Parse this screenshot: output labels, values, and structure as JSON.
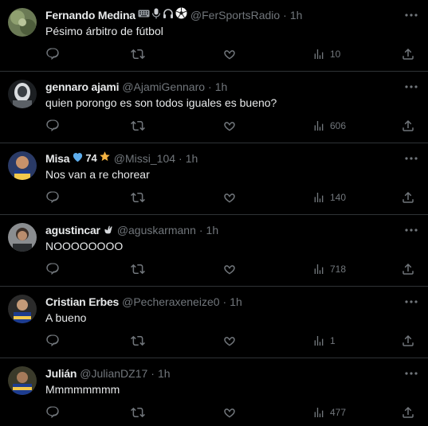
{
  "tweets": [
    {
      "name": "Fernando Medina",
      "name_emojis": [
        "keyboard-icon",
        "microphone-icon",
        "headphones-icon",
        "soccer-ball-icon"
      ],
      "handle": "@FerSportsRadio",
      "time": "1h",
      "text": "Pésimo árbitro de fútbol",
      "views": "10"
    },
    {
      "name": "gennaro ajami",
      "handle": "@AjamiGennaro",
      "time": "1h",
      "text": "quien porongo es son todos iguales es bueno?",
      "views": "606"
    },
    {
      "name": "Misa",
      "name_suffix": "74",
      "name_emojis": [
        "blue-heart-icon",
        "star-icon"
      ],
      "handle": "@Missi_104",
      "time": "1h",
      "text": "Nos van a re chorear",
      "views": "140"
    },
    {
      "name": "agustincar",
      "name_emojis": [
        "hand-icon"
      ],
      "handle": "@aguskarmann",
      "time": "1h",
      "text": "NOOOOOOOO",
      "views": "718"
    },
    {
      "name": "Cristian Erbes",
      "handle": "@Pecheraxeneize0",
      "time": "1h",
      "text": "A bueno",
      "views": "1"
    },
    {
      "name": "Julián",
      "handle": "@JulianDZ17",
      "time": "1h",
      "text": "Mmmmmmmm",
      "views": "477"
    }
  ],
  "separator": "·",
  "colors": {
    "background": "#000000",
    "text": "#e7e9ea",
    "muted": "#71767b",
    "border": "#2f3336"
  }
}
